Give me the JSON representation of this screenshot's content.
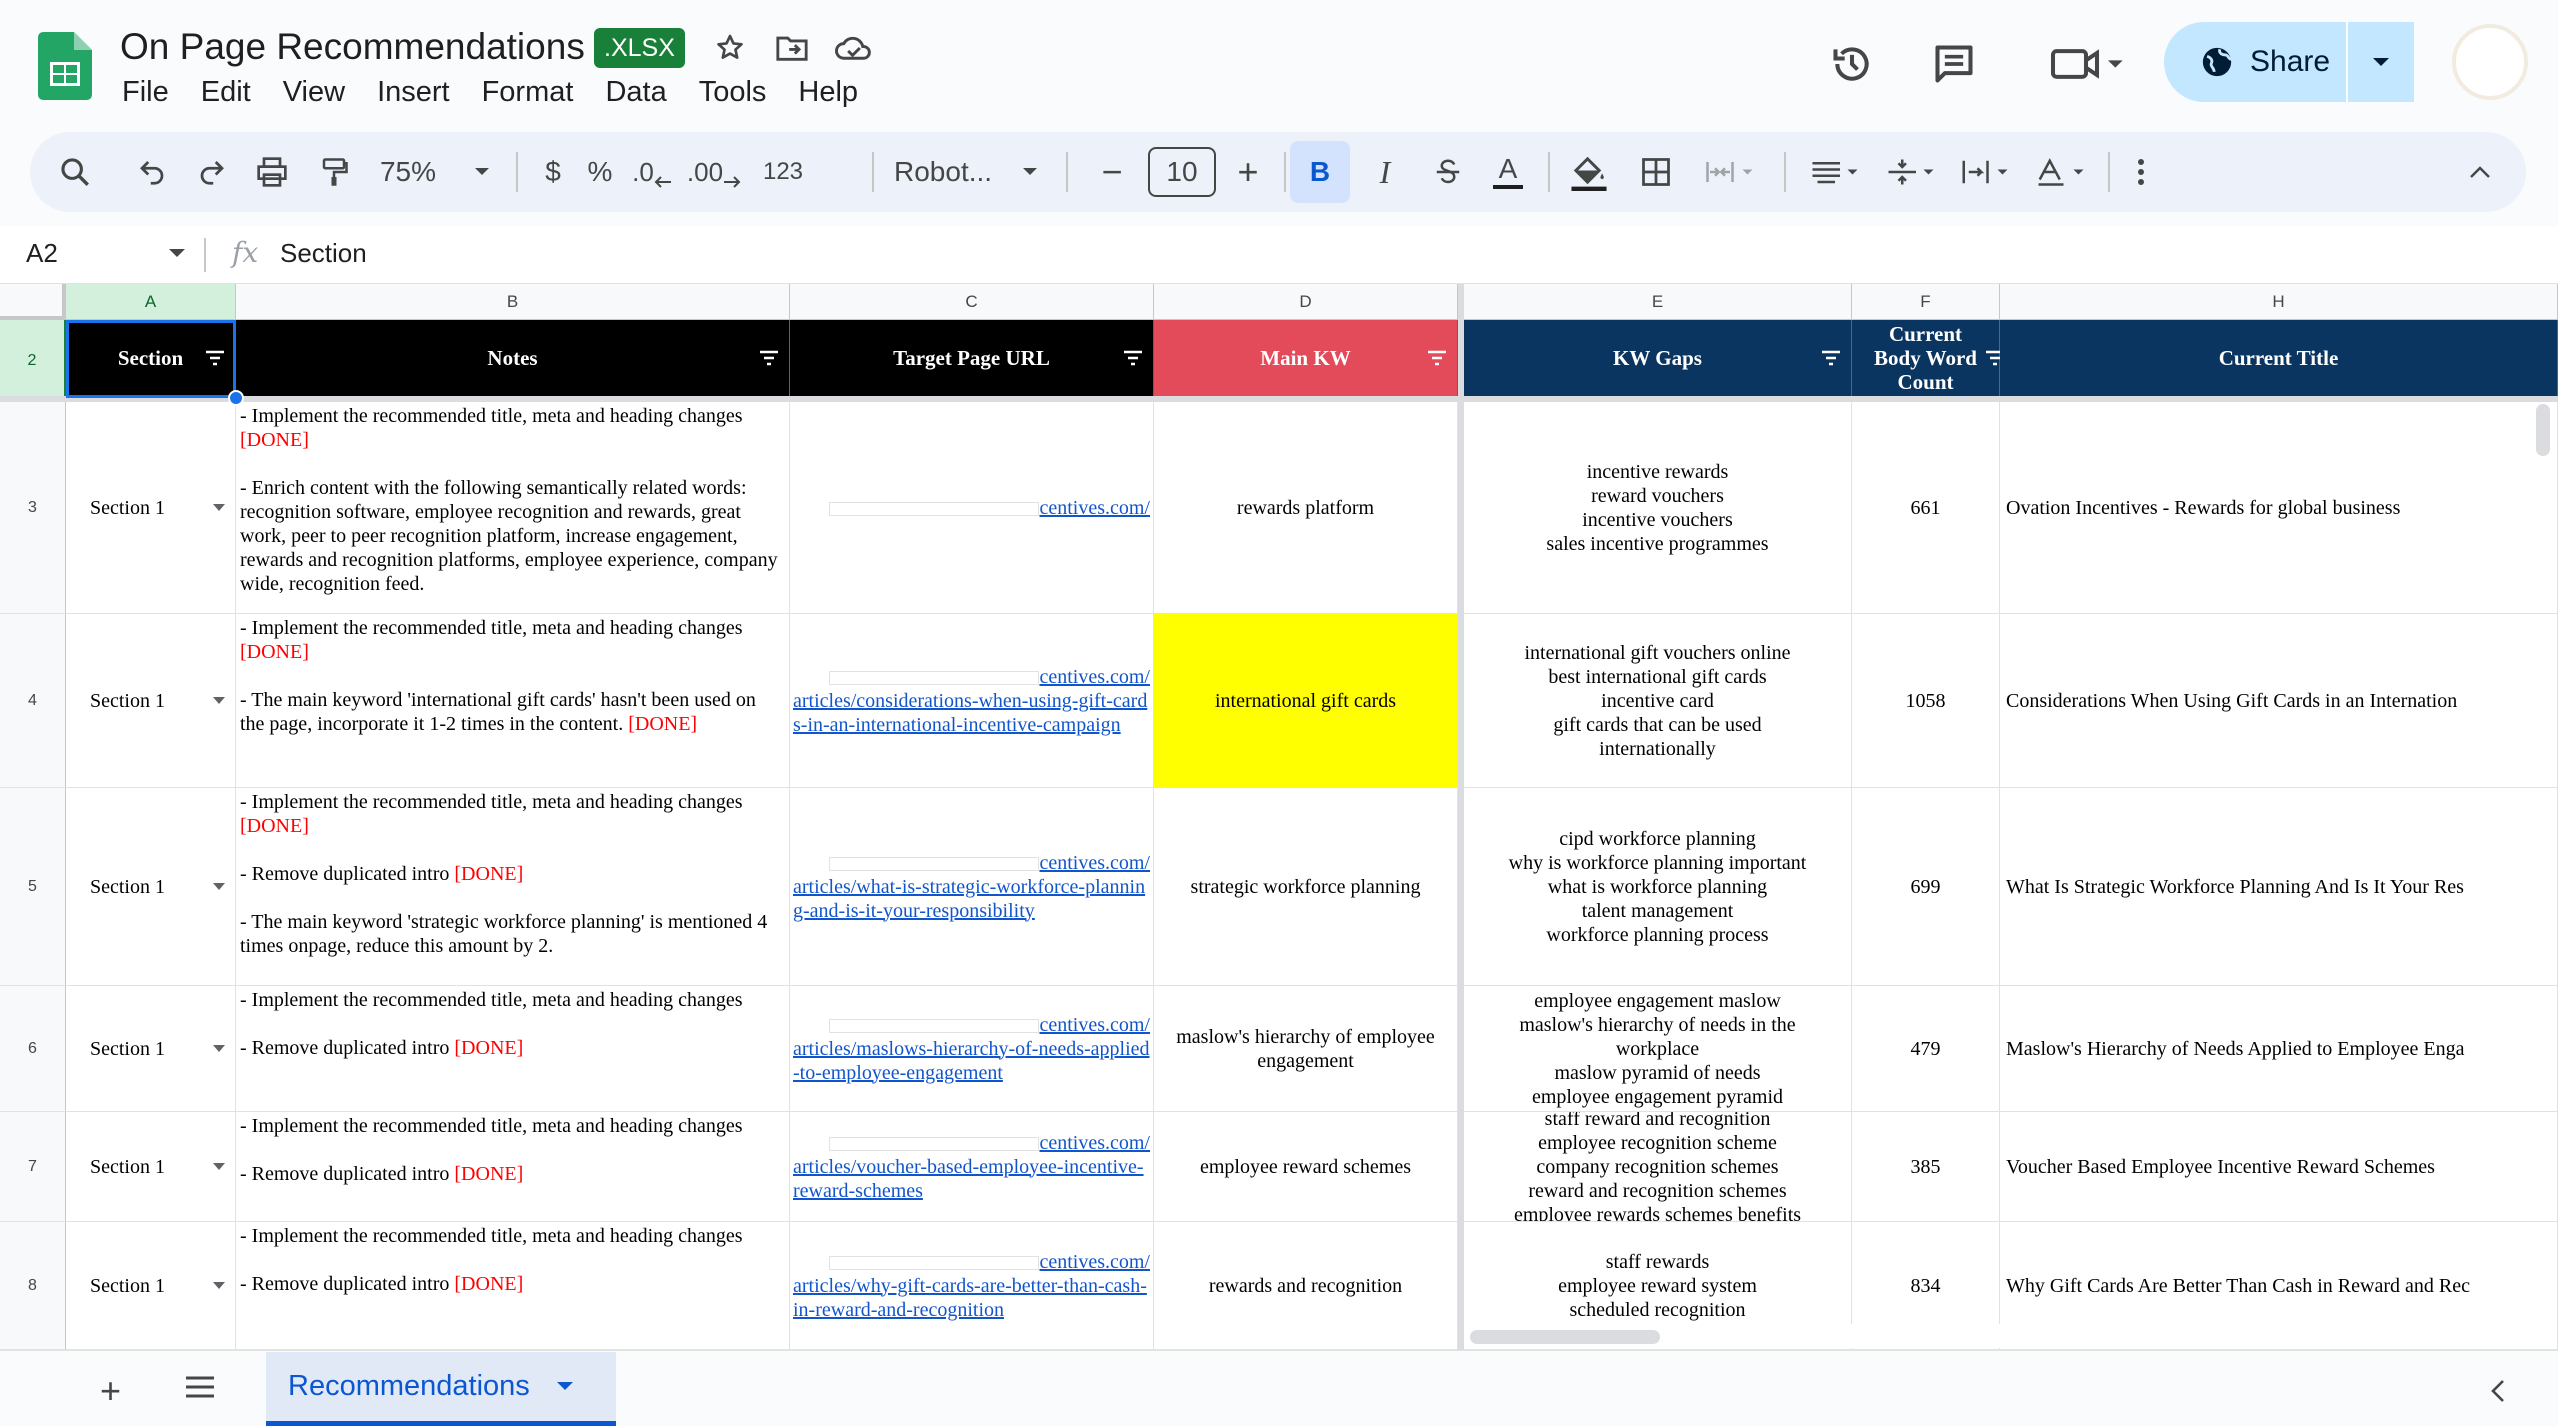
{
  "app": {
    "title": "On Page Recommendations",
    "file_badge": ".XLSX",
    "menu": [
      "File",
      "Edit",
      "View",
      "Insert",
      "Format",
      "Data",
      "Tools",
      "Help"
    ],
    "share_label": "Share"
  },
  "toolbar": {
    "zoom": "75%",
    "currency": "$",
    "percent": "%",
    "dec_decrease": ".0",
    "dec_increase": ".00",
    "number_format": "123",
    "font": "Robot...",
    "font_size": "10",
    "minus": "−",
    "plus": "+",
    "bold": "B",
    "italic": "I",
    "text_color": "A"
  },
  "formula_bar": {
    "cell_ref": "A2",
    "fx": "fx",
    "value": "Section"
  },
  "columns": [
    "A",
    "B",
    "C",
    "D",
    "E",
    "F",
    "H"
  ],
  "rows": [
    "2",
    "3",
    "4",
    "5",
    "6",
    "7",
    "8"
  ],
  "headers": {
    "section": "Section",
    "notes": "Notes",
    "url": "Target Page URL",
    "main_kw": "Main KW",
    "kw_gaps": "KW Gaps",
    "word_count_1": "Current",
    "word_count_2": "Body Word",
    "word_count_3": "Count",
    "title": "Current Title"
  },
  "colors": {
    "header_black": "#000000",
    "header_red": "#e34a5a",
    "header_navy": "#0b3561",
    "highlight_yellow": "#ffff00",
    "done_red": "#ff0000"
  },
  "data_rows": [
    {
      "section": "Section 1",
      "notes": [
        {
          "t": "- Implement the recommended title, meta and heading changes "
        },
        {
          "t": "[DONE]",
          "done": true
        },
        {
          "t": "\n\n- Enrich content with the following semantically related words:\nrecognition software, employee recognition and rewards, great work, peer to peer recognition platform, increase engagement, rewards and recognition platforms, employee experience, company wide, recognition feed."
        }
      ],
      "url_lines": [
        "centives.com/"
      ],
      "main_kw": "rewards platform",
      "kw_gaps": [
        "incentive rewards",
        "reward vouchers",
        "incentive vouchers",
        "sales incentive programmes"
      ],
      "word_count": "661",
      "title": "Ovation Incentives - Rewards for global business"
    },
    {
      "section": "Section 1",
      "notes": [
        {
          "t": "- Implement the recommended title, meta and heading changes "
        },
        {
          "t": "[DONE]",
          "done": true
        },
        {
          "t": "\n\n- The main keyword 'international gift cards' hasn't been used on the page, incorporate it 1-2 times in the content. "
        },
        {
          "t": "[DONE]",
          "done": true
        }
      ],
      "url_lines": [
        "centives.com/",
        "articles/considerations-when-using-gift-cards-in-an-international-incentive-campaign"
      ],
      "main_kw": "international gift cards",
      "highlight": true,
      "kw_gaps": [
        "international gift vouchers online",
        "best international gift cards",
        "incentive card",
        "gift cards that can be used",
        "internationally"
      ],
      "word_count": "1058",
      "title": "Considerations When Using Gift Cards in an Internation"
    },
    {
      "section": "Section 1",
      "notes": [
        {
          "t": "- Implement the recommended title, meta and heading changes "
        },
        {
          "t": "[DONE]",
          "done": true
        },
        {
          "t": "\n\n- Remove duplicated intro "
        },
        {
          "t": "[DONE]",
          "done": true
        },
        {
          "t": "\n\n- The main keyword 'strategic workforce planning' is mentioned 4 times onpage, reduce this amount by 2."
        }
      ],
      "url_lines": [
        "centives.com/",
        "articles/what-is-strategic-workforce-planning-and-is-it-your-responsibility"
      ],
      "main_kw": "strategic workforce planning",
      "kw_gaps": [
        "cipd workforce planning",
        "why is workforce planning important",
        "what is workforce planning",
        "talent management",
        "workforce planning process"
      ],
      "word_count": "699",
      "title": "What Is Strategic Workforce Planning And Is It Your Res"
    },
    {
      "section": "Section 1",
      "notes": [
        {
          "t": "- Implement the recommended title, meta and heading changes\n\n- Remove duplicated intro "
        },
        {
          "t": "[DONE]",
          "done": true
        }
      ],
      "url_lines": [
        "centives.com/",
        "articles/maslows-hierarchy-of-needs-applied-to-employee-engagement"
      ],
      "main_kw": "maslow's hierarchy of employee engagement",
      "kw_gaps": [
        "employee engagement maslow",
        "maslow's hierarchy of needs in the",
        "workplace",
        "maslow pyramid of needs",
        "employee engagement pyramid"
      ],
      "word_count": "479",
      "title": "Maslow's Hierarchy of Needs Applied to Employee Enga"
    },
    {
      "section": "Section 1",
      "notes": [
        {
          "t": "- Implement the recommended title, meta and heading changes\n\n- Remove duplicated intro "
        },
        {
          "t": "[DONE]",
          "done": true
        }
      ],
      "url_lines": [
        "centives.com/",
        "articles/voucher-based-employee-incentive-reward-schemes"
      ],
      "main_kw": "employee reward schemes",
      "kw_gaps": [
        "staff reward and recognition",
        "employee recognition scheme",
        "company recognition schemes",
        "reward and recognition schemes",
        "employee rewards schemes benefits"
      ],
      "word_count": "385",
      "title": "Voucher Based Employee Incentive Reward Schemes"
    },
    {
      "section": "Section 1",
      "notes": [
        {
          "t": "- Implement the recommended title, meta and heading changes\n\n- Remove duplicated intro "
        },
        {
          "t": "[DONE]",
          "done": true
        }
      ],
      "url_lines": [
        "centives.com/",
        "articles/why-gift-cards-are-better-than-cash-in-reward-and-recognition"
      ],
      "main_kw": "rewards and recognition",
      "kw_gaps": [
        "staff rewards",
        "employee reward system",
        "scheduled recognition"
      ],
      "word_count": "834",
      "title": "Why Gift Cards Are Better Than Cash in Reward and Rec"
    }
  ],
  "sheet_tab": "Recommendations"
}
